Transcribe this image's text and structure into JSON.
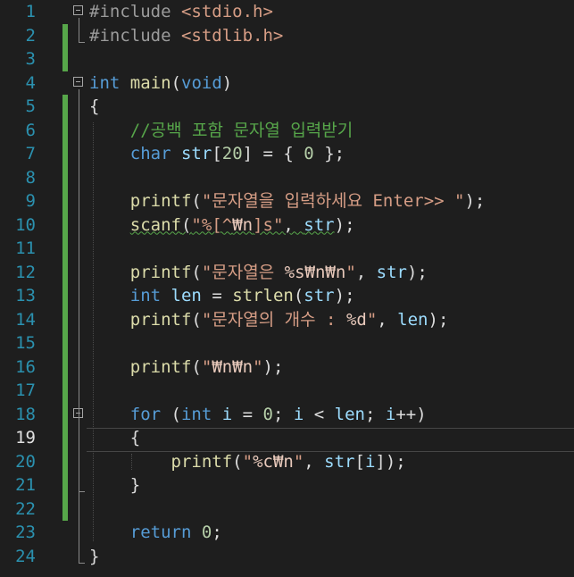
{
  "editor": {
    "current_line": 19,
    "lines": [
      {
        "no": "1",
        "tokens": [
          {
            "c": "pp",
            "t": "#include "
          },
          {
            "c": "str",
            "t": "<stdio.h>"
          }
        ]
      },
      {
        "no": "2",
        "tokens": [
          {
            "c": "pp",
            "t": "#include "
          },
          {
            "c": "str",
            "t": "<stdlib.h>"
          }
        ]
      },
      {
        "no": "3",
        "tokens": []
      },
      {
        "no": "4",
        "tokens": [
          {
            "c": "kw",
            "t": "int"
          },
          {
            "c": "plain",
            "t": " "
          },
          {
            "c": "fn",
            "t": "main"
          },
          {
            "c": "plain",
            "t": "("
          },
          {
            "c": "kw",
            "t": "void"
          },
          {
            "c": "plain",
            "t": ")"
          }
        ]
      },
      {
        "no": "5",
        "tokens": [
          {
            "c": "plain",
            "t": "{"
          }
        ]
      },
      {
        "no": "6",
        "tokens": [
          {
            "c": "plain",
            "t": "    "
          },
          {
            "c": "cm",
            "t": "//공백 포함 문자열 입력받기"
          }
        ]
      },
      {
        "no": "7",
        "tokens": [
          {
            "c": "plain",
            "t": "    "
          },
          {
            "c": "kw",
            "t": "char"
          },
          {
            "c": "plain",
            "t": " "
          },
          {
            "c": "var",
            "t": "str"
          },
          {
            "c": "plain",
            "t": "["
          },
          {
            "c": "num",
            "t": "20"
          },
          {
            "c": "plain",
            "t": "] = { "
          },
          {
            "c": "num",
            "t": "0"
          },
          {
            "c": "plain",
            "t": " };"
          }
        ]
      },
      {
        "no": "8",
        "tokens": []
      },
      {
        "no": "9",
        "tokens": [
          {
            "c": "plain",
            "t": "    "
          },
          {
            "c": "fn",
            "t": "printf"
          },
          {
            "c": "plain",
            "t": "("
          },
          {
            "c": "str",
            "t": "\"문자열을 입력하세요 Enter>> \""
          },
          {
            "c": "plain",
            "t": ");"
          }
        ]
      },
      {
        "no": "10",
        "tokens": [
          {
            "c": "plain",
            "t": "    "
          },
          {
            "c": "fn squig",
            "t": "scanf"
          },
          {
            "c": "plain squig",
            "t": "("
          },
          {
            "c": "str squig",
            "t": "\"%[^"
          },
          {
            "c": "esc squig",
            "t": "₩n"
          },
          {
            "c": "str squig",
            "t": "]s\""
          },
          {
            "c": "plain squig",
            "t": ", "
          },
          {
            "c": "var squig",
            "t": "str"
          },
          {
            "c": "plain",
            "t": ");"
          }
        ]
      },
      {
        "no": "11",
        "tokens": []
      },
      {
        "no": "12",
        "tokens": [
          {
            "c": "plain",
            "t": "    "
          },
          {
            "c": "fn",
            "t": "printf"
          },
          {
            "c": "plain",
            "t": "("
          },
          {
            "c": "str",
            "t": "\"문자열은 "
          },
          {
            "c": "esc",
            "t": "%s₩n₩n"
          },
          {
            "c": "str",
            "t": "\""
          },
          {
            "c": "plain",
            "t": ", "
          },
          {
            "c": "var",
            "t": "str"
          },
          {
            "c": "plain",
            "t": ");"
          }
        ]
      },
      {
        "no": "13",
        "tokens": [
          {
            "c": "plain",
            "t": "    "
          },
          {
            "c": "kw",
            "t": "int"
          },
          {
            "c": "plain",
            "t": " "
          },
          {
            "c": "var",
            "t": "len"
          },
          {
            "c": "plain",
            "t": " = "
          },
          {
            "c": "fn",
            "t": "strlen"
          },
          {
            "c": "plain",
            "t": "("
          },
          {
            "c": "var",
            "t": "str"
          },
          {
            "c": "plain",
            "t": ");"
          }
        ]
      },
      {
        "no": "14",
        "tokens": [
          {
            "c": "plain",
            "t": "    "
          },
          {
            "c": "fn",
            "t": "printf"
          },
          {
            "c": "plain",
            "t": "("
          },
          {
            "c": "str",
            "t": "\"문자열의 개수 : "
          },
          {
            "c": "esc",
            "t": "%d"
          },
          {
            "c": "str",
            "t": "\""
          },
          {
            "c": "plain",
            "t": ", "
          },
          {
            "c": "var",
            "t": "len"
          },
          {
            "c": "plain",
            "t": ");"
          }
        ]
      },
      {
        "no": "15",
        "tokens": []
      },
      {
        "no": "16",
        "tokens": [
          {
            "c": "plain",
            "t": "    "
          },
          {
            "c": "fn",
            "t": "printf"
          },
          {
            "c": "plain",
            "t": "("
          },
          {
            "c": "str",
            "t": "\""
          },
          {
            "c": "esc",
            "t": "₩n₩n"
          },
          {
            "c": "str",
            "t": "\""
          },
          {
            "c": "plain",
            "t": ");"
          }
        ]
      },
      {
        "no": "17",
        "tokens": []
      },
      {
        "no": "18",
        "tokens": [
          {
            "c": "plain",
            "t": "    "
          },
          {
            "c": "kw",
            "t": "for"
          },
          {
            "c": "plain",
            "t": " ("
          },
          {
            "c": "kw",
            "t": "int"
          },
          {
            "c": "plain",
            "t": " "
          },
          {
            "c": "var",
            "t": "i"
          },
          {
            "c": "plain",
            "t": " = "
          },
          {
            "c": "num",
            "t": "0"
          },
          {
            "c": "plain",
            "t": "; "
          },
          {
            "c": "var",
            "t": "i"
          },
          {
            "c": "plain",
            "t": " < "
          },
          {
            "c": "var",
            "t": "len"
          },
          {
            "c": "plain",
            "t": "; "
          },
          {
            "c": "var",
            "t": "i"
          },
          {
            "c": "plain",
            "t": "++)"
          }
        ]
      },
      {
        "no": "19",
        "tokens": [
          {
            "c": "plain",
            "t": "    {"
          }
        ]
      },
      {
        "no": "20",
        "tokens": [
          {
            "c": "plain",
            "t": "        "
          },
          {
            "c": "fn",
            "t": "printf"
          },
          {
            "c": "plain",
            "t": "("
          },
          {
            "c": "str",
            "t": "\""
          },
          {
            "c": "esc",
            "t": "%c₩n"
          },
          {
            "c": "str",
            "t": "\""
          },
          {
            "c": "plain",
            "t": ", "
          },
          {
            "c": "var",
            "t": "str"
          },
          {
            "c": "plain",
            "t": "["
          },
          {
            "c": "var",
            "t": "i"
          },
          {
            "c": "plain",
            "t": "]);"
          }
        ]
      },
      {
        "no": "21",
        "tokens": [
          {
            "c": "plain",
            "t": "    }"
          }
        ]
      },
      {
        "no": "22",
        "tokens": []
      },
      {
        "no": "23",
        "tokens": [
          {
            "c": "plain",
            "t": "    "
          },
          {
            "c": "kw",
            "t": "return"
          },
          {
            "c": "plain",
            "t": " "
          },
          {
            "c": "num",
            "t": "0"
          },
          {
            "c": "plain",
            "t": ";"
          }
        ]
      },
      {
        "no": "24",
        "tokens": [
          {
            "c": "plain",
            "t": "}"
          }
        ]
      }
    ],
    "changed_lines": [
      2,
      3,
      5,
      6,
      7,
      8,
      9,
      10,
      11,
      12,
      13,
      14,
      15,
      16,
      17,
      18,
      19,
      20,
      21,
      22
    ],
    "fold_lines": [
      1,
      4,
      18
    ],
    "colors": {
      "background": "#1e1e1e",
      "line_number": "#2b91af",
      "keyword": "#569cd6",
      "string": "#d69d85",
      "comment": "#57a64a",
      "function": "#dcdcaa",
      "change_bar": "#57a64a"
    }
  }
}
